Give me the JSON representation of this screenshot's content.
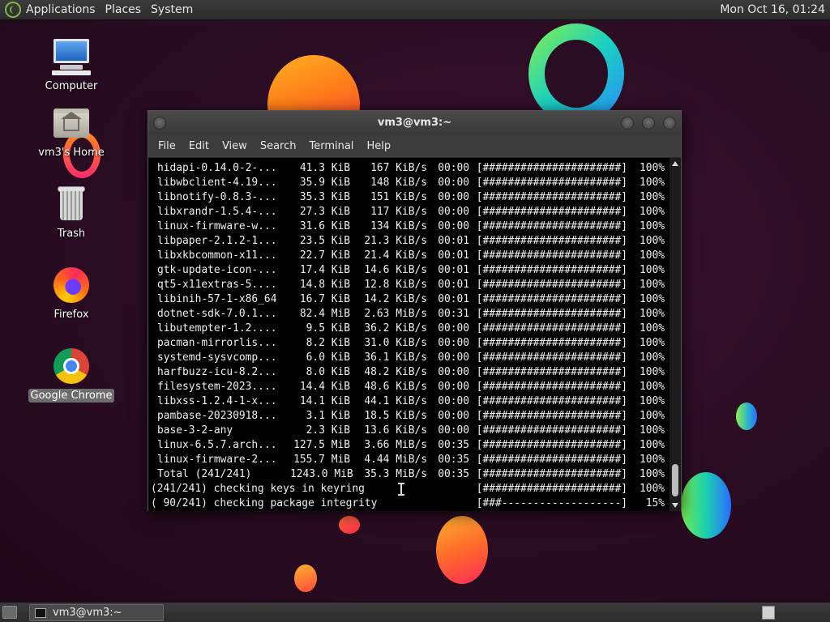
{
  "top_panel": {
    "menus": [
      "Applications",
      "Places",
      "System"
    ],
    "clock": "Mon Oct 16, 01:24"
  },
  "desktop": {
    "icons": [
      {
        "label": "Computer",
        "icon": "computer-icon"
      },
      {
        "label": "vm3's Home",
        "icon": "home-folder-icon"
      },
      {
        "label": "Trash",
        "icon": "trash-icon"
      },
      {
        "label": "Firefox",
        "icon": "firefox-icon"
      },
      {
        "label": "Google Chrome",
        "icon": "chrome-icon",
        "selected": true
      }
    ]
  },
  "terminal": {
    "title": "vm3@vm3:~",
    "menus": [
      "File",
      "Edit",
      "View",
      "Search",
      "Terminal",
      "Help"
    ],
    "download_rows": [
      {
        "name": "hidapi-0.14.0-2-...",
        "size": "41.3 KiB",
        "speed": "167 KiB/s",
        "time": "00:00",
        "bar": "[######################]",
        "pct": "100%"
      },
      {
        "name": "libwbclient-4.19...",
        "size": "35.9 KiB",
        "speed": "148 KiB/s",
        "time": "00:00",
        "bar": "[######################]",
        "pct": "100%"
      },
      {
        "name": "libnotify-0.8.3-...",
        "size": "35.3 KiB",
        "speed": "151 KiB/s",
        "time": "00:00",
        "bar": "[######################]",
        "pct": "100%"
      },
      {
        "name": "libxrandr-1.5.4-...",
        "size": "27.3 KiB",
        "speed": "117 KiB/s",
        "time": "00:00",
        "bar": "[######################]",
        "pct": "100%"
      },
      {
        "name": "linux-firmware-w...",
        "size": "31.6 KiB",
        "speed": "134 KiB/s",
        "time": "00:00",
        "bar": "[######################]",
        "pct": "100%"
      },
      {
        "name": "libpaper-2.1.2-1...",
        "size": "23.5 KiB",
        "speed": "21.3 KiB/s",
        "time": "00:01",
        "bar": "[######################]",
        "pct": "100%"
      },
      {
        "name": "libxkbcommon-x11...",
        "size": "22.7 KiB",
        "speed": "21.4 KiB/s",
        "time": "00:01",
        "bar": "[######################]",
        "pct": "100%"
      },
      {
        "name": "gtk-update-icon-...",
        "size": "17.4 KiB",
        "speed": "14.6 KiB/s",
        "time": "00:01",
        "bar": "[######################]",
        "pct": "100%"
      },
      {
        "name": "qt5-x11extras-5....",
        "size": "14.8 KiB",
        "speed": "12.8 KiB/s",
        "time": "00:01",
        "bar": "[######################]",
        "pct": "100%"
      },
      {
        "name": "libinih-57-1-x86_64",
        "size": "16.7 KiB",
        "speed": "14.2 KiB/s",
        "time": "00:01",
        "bar": "[######################]",
        "pct": "100%"
      },
      {
        "name": "dotnet-sdk-7.0.1...",
        "size": "82.4 MiB",
        "speed": "2.63 MiB/s",
        "time": "00:31",
        "bar": "[######################]",
        "pct": "100%"
      },
      {
        "name": "libutempter-1.2....",
        "size": "9.5 KiB",
        "speed": "36.2 KiB/s",
        "time": "00:00",
        "bar": "[######################]",
        "pct": "100%"
      },
      {
        "name": "pacman-mirrorlis...",
        "size": "8.2 KiB",
        "speed": "31.0 KiB/s",
        "time": "00:00",
        "bar": "[######################]",
        "pct": "100%"
      },
      {
        "name": "systemd-sysvcomp...",
        "size": "6.0 KiB",
        "speed": "36.1 KiB/s",
        "time": "00:00",
        "bar": "[######################]",
        "pct": "100%"
      },
      {
        "name": "harfbuzz-icu-8.2...",
        "size": "8.0 KiB",
        "speed": "48.2 KiB/s",
        "time": "00:00",
        "bar": "[######################]",
        "pct": "100%"
      },
      {
        "name": "filesystem-2023....",
        "size": "14.4 KiB",
        "speed": "48.6 KiB/s",
        "time": "00:00",
        "bar": "[######################]",
        "pct": "100%"
      },
      {
        "name": "libxss-1.2.4-1-x...",
        "size": "14.1 KiB",
        "speed": "44.1 KiB/s",
        "time": "00:00",
        "bar": "[######################]",
        "pct": "100%"
      },
      {
        "name": "pambase-20230918...",
        "size": "3.1 KiB",
        "speed": "18.5 KiB/s",
        "time": "00:00",
        "bar": "[######################]",
        "pct": "100%"
      },
      {
        "name": "base-3-2-any",
        "size": "2.3 KiB",
        "speed": "13.6 KiB/s",
        "time": "00:00",
        "bar": "[######################]",
        "pct": "100%"
      },
      {
        "name": "linux-6.5.7.arch...",
        "size": "127.5 MiB",
        "speed": "3.66 MiB/s",
        "time": "00:35",
        "bar": "[######################]",
        "pct": "100%"
      },
      {
        "name": "linux-firmware-2...",
        "size": "155.7 MiB",
        "speed": "4.44 MiB/s",
        "time": "00:35",
        "bar": "[######################]",
        "pct": "100%"
      },
      {
        "name": "Total (241/241)",
        "size": "1243.0 MiB",
        "speed": "35.3 MiB/s",
        "time": "00:35",
        "bar": "[######################]",
        "pct": "100%"
      }
    ],
    "status_rows": [
      {
        "msg": "(241/241) checking keys in keyring",
        "bar": "[######################]",
        "pct": "100%"
      },
      {
        "msg": "( 90/241) checking package integrity",
        "bar": "[###-------------------]",
        "pct": "15%"
      }
    ]
  },
  "taskbar": {
    "task_label": "vm3@vm3:~"
  }
}
